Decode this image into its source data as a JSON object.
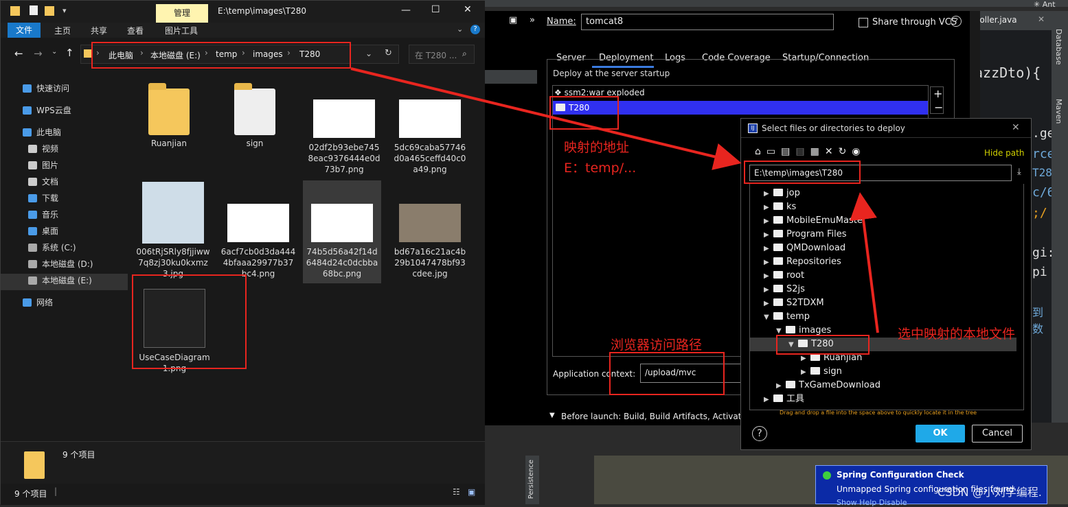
{
  "explorer": {
    "title": "E:\\temp\\images\\T280",
    "manage_tab": "管理",
    "ribbon_tabs": [
      "文件",
      "主页",
      "共享",
      "查看",
      "图片工具"
    ],
    "breadcrumb": [
      "此电脑",
      "本地磁盘 (E:)",
      "temp",
      "images",
      "T280"
    ],
    "search_placeholder": "在 T280 ...",
    "nav_items": [
      {
        "label": "快速访问",
        "icon": "star-icon"
      },
      {
        "label": "WPS云盘",
        "icon": "cloud-icon"
      },
      {
        "label": "此电脑",
        "icon": "computer-icon"
      },
      {
        "label": "视频",
        "icon": "video-icon"
      },
      {
        "label": "图片",
        "icon": "picture-icon"
      },
      {
        "label": "文档",
        "icon": "document-icon"
      },
      {
        "label": "下载",
        "icon": "download-icon"
      },
      {
        "label": "音乐",
        "icon": "music-icon"
      },
      {
        "label": "桌面",
        "icon": "desktop-icon"
      },
      {
        "label": "系统 (C:)",
        "icon": "drive-icon"
      },
      {
        "label": "本地磁盘 (D:)",
        "icon": "drive-icon"
      },
      {
        "label": "本地磁盘 (E:)",
        "icon": "drive-icon"
      },
      {
        "label": "网络",
        "icon": "network-icon"
      }
    ],
    "files": [
      {
        "name": "Ruanjian",
        "kind": "folder"
      },
      {
        "name": "sign",
        "kind": "folder"
      },
      {
        "name": "02df2b93ebe7458eac9376444e0d73b7.png",
        "kind": "image"
      },
      {
        "name": "5dc69caba57746d0a465ceffd40c0a49.png",
        "kind": "image"
      },
      {
        "name": "006tRjSRly8fjjiww7q8zj30ku0kxmz3.jpg",
        "kind": "image"
      },
      {
        "name": "6acf7cb0d3da4444bfaaa29977b37bc4.png",
        "kind": "image"
      },
      {
        "name": "74b5d56a42f14d6484d24c0dcbba68bc.png",
        "kind": "image"
      },
      {
        "name": "bd67a16c21ac4b29b1047478bf93cdee.jpg",
        "kind": "image"
      },
      {
        "name": "UseCaseDiagram1.png",
        "kind": "image"
      }
    ],
    "preview_count": "9 个项目",
    "status_count": "9 个项目"
  },
  "run_config": {
    "name_label": "Name:",
    "name_value": "tomcat8",
    "share_label": "Share through VCS",
    "tabs": [
      "Server",
      "Deployment",
      "Logs",
      "Code Coverage",
      "Startup/Connection"
    ],
    "active_tab": "Deployment",
    "deploy_label": "Deploy at the server startup",
    "artifacts": [
      "ssm2:war exploded",
      "T280"
    ],
    "app_context_label": "Application context:",
    "app_context_value": "/upload/mvc",
    "before_launch": "Before launch: Build, Build Artifacts, Activate t"
  },
  "chooser": {
    "title": "Select files or directories to deploy",
    "hide_path": "Hide path",
    "path_value": "E:\\temp\\images\\T280",
    "tree": [
      {
        "label": "jop",
        "level": 0,
        "arrow": "▶"
      },
      {
        "label": "ks",
        "level": 0,
        "arrow": "▶"
      },
      {
        "label": "MobileEmuMaster",
        "level": 0,
        "arrow": "▶"
      },
      {
        "label": "Program Files",
        "level": 0,
        "arrow": "▶"
      },
      {
        "label": "QMDownload",
        "level": 0,
        "arrow": "▶"
      },
      {
        "label": "Repositories",
        "level": 0,
        "arrow": "▶"
      },
      {
        "label": "root",
        "level": 0,
        "arrow": "▶"
      },
      {
        "label": "S2js",
        "level": 0,
        "arrow": "▶"
      },
      {
        "label": "S2TDXM",
        "level": 0,
        "arrow": "▶"
      },
      {
        "label": "temp",
        "level": 0,
        "arrow": "▼"
      },
      {
        "label": "images",
        "level": 1,
        "arrow": "▼"
      },
      {
        "label": "T280",
        "level": 2,
        "arrow": "▼",
        "selected": true
      },
      {
        "label": "Ruanjian",
        "level": 3,
        "arrow": "▶"
      },
      {
        "label": "sign",
        "level": 3,
        "arrow": "▶"
      },
      {
        "label": "TxGameDownload",
        "level": 1,
        "arrow": "▶"
      },
      {
        "label": "工具",
        "level": 0,
        "arrow": "▶"
      }
    ],
    "hint": "Drag and drop a file into the space above to quickly locate it in the tree",
    "ok": "OK",
    "cancel": "Cancel"
  },
  "annotations": {
    "mapping_title": "映射的地址",
    "mapping_path": "E：temp/...",
    "browser_path": "浏览器访问路径",
    "select_local": "选中映射的本地文件"
  },
  "ide": {
    "editor_tab": "troller.java",
    "side_labels": [
      "Database",
      "Maven"
    ],
    "code_fragments": [
      "azzDto){",
      ".ge",
      "rce",
      "T28",
      "c/6",
      ";/",
      "gi:",
      "pi",
      "到数"
    ],
    "persistence": "Persistence",
    "ant": "Ant",
    "notif_title": "Spring Configuration Check",
    "notif_body": "Unmapped Spring configuration files found",
    "notif_links": "Show  Help  Disable",
    "watermark": "CSDN @小刘学编程."
  },
  "colors": {
    "selection_blue": "#3030f0",
    "red": "#e8251f",
    "ok_blue": "#1fa9e8"
  }
}
